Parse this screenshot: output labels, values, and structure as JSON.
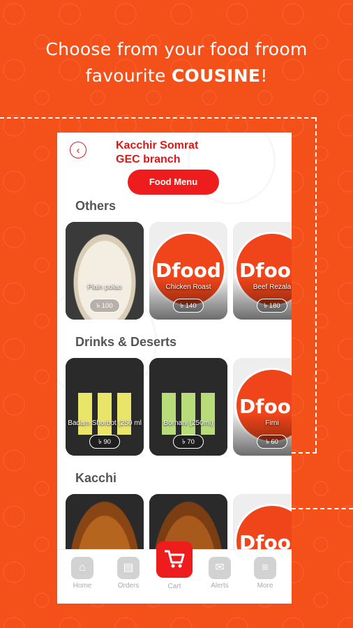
{
  "promo": {
    "line1": "Choose from your food froom",
    "line2_prefix": "favourite ",
    "line2_bold": "COUSINE",
    "line2_suffix": "!"
  },
  "header": {
    "back_icon": "‹",
    "branch_line1": "Kacchir Somrat",
    "branch_line2": "GEC branch",
    "menu_button": "Food Menu"
  },
  "sections": [
    {
      "title": "Others",
      "items": [
        {
          "name": "Plain polao",
          "price": "৳ 100",
          "image": "photo"
        },
        {
          "name": "Chicken Roast",
          "price": "৳ 140",
          "image": "logo"
        },
        {
          "name": "Beef Rezala",
          "price": "৳ 180",
          "image": "logo"
        }
      ]
    },
    {
      "title": "Drinks & Deserts",
      "items": [
        {
          "name": "Badam Shorbot (250 ml",
          "price": "৳ 90",
          "image": "photo"
        },
        {
          "name": "Borhani (250ml)",
          "price": "৳ 70",
          "image": "photo"
        },
        {
          "name": "Firni",
          "price": "৳ 60",
          "image": "logo"
        }
      ]
    },
    {
      "title": "Kacchi",
      "items": [
        {
          "name": "",
          "price": "",
          "image": "photo"
        },
        {
          "name": "",
          "price": "",
          "image": "photo"
        },
        {
          "name": "",
          "price": "",
          "image": "logo"
        }
      ]
    }
  ],
  "logo_text": "Dfood",
  "tabbar": {
    "home": "Home",
    "orders": "Orders",
    "cart": "Cart",
    "alerts": "Alerts",
    "more": "More"
  },
  "colors": {
    "brand_orange": "#f4501a",
    "accent_red": "#ee1c1c"
  }
}
